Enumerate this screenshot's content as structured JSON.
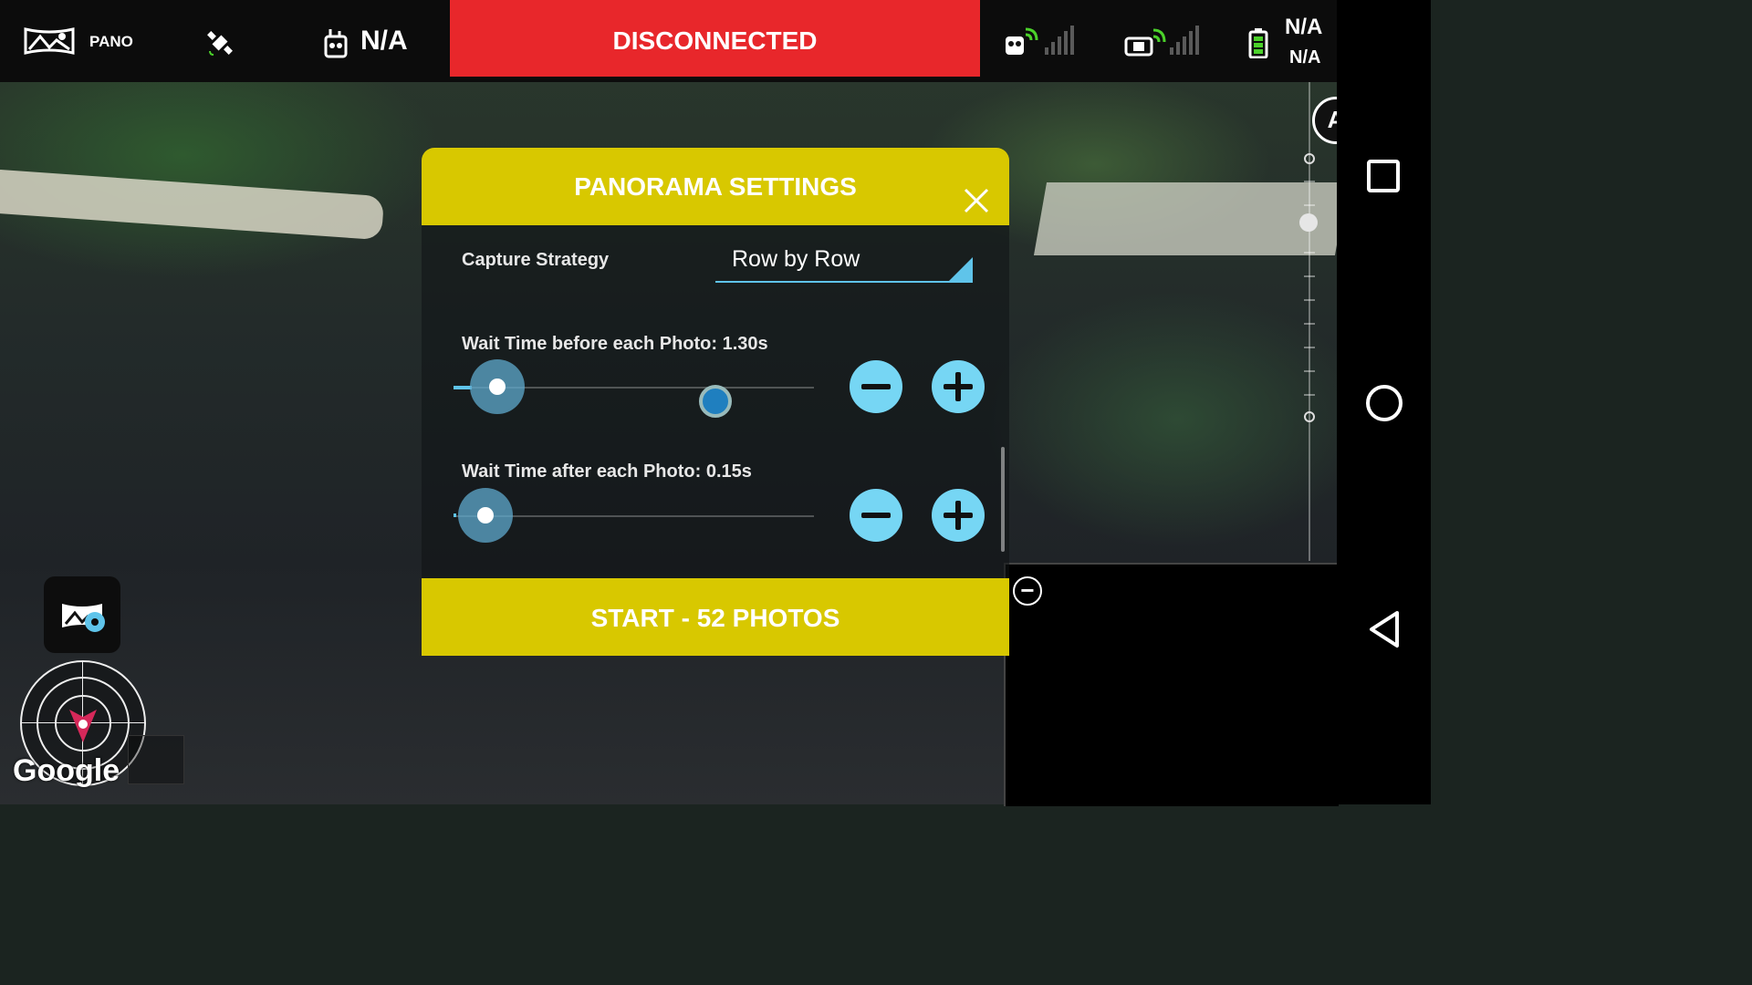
{
  "topbar": {
    "mode_label": "PANO",
    "remote_value": "N/A",
    "connection_status": "DISCONNECTED",
    "battery_primary": "N/A",
    "battery_secondary": "N/A"
  },
  "panel": {
    "title": "PANORAMA SETTINGS",
    "capture_strategy_label": "Capture Strategy",
    "capture_strategy_value": "Row by Row",
    "wait_before_label": "Wait Time before each Photo: 1.30s",
    "wait_after_label": "Wait Time after each Photo: 0.15s",
    "start_label": "START - 52 PHOTOS"
  },
  "map": {
    "attribution": "Google"
  },
  "colors": {
    "accent_yellow": "#d8c800",
    "status_red": "#e8272b",
    "slider_blue": "#5fc4ea",
    "button_blue": "#76d6f4",
    "signal_green": "#4bd12a"
  },
  "icons": [
    "panorama-icon",
    "satellite-icon",
    "remote-controller-icon",
    "drone-signal-icon",
    "camera-signal-icon",
    "battery-icon",
    "close-icon",
    "minus-icon",
    "plus-icon",
    "square-nav-icon",
    "circle-nav-icon",
    "back-nav-icon",
    "compass-icon",
    "panorama-settings-icon",
    "radar-icon"
  ]
}
